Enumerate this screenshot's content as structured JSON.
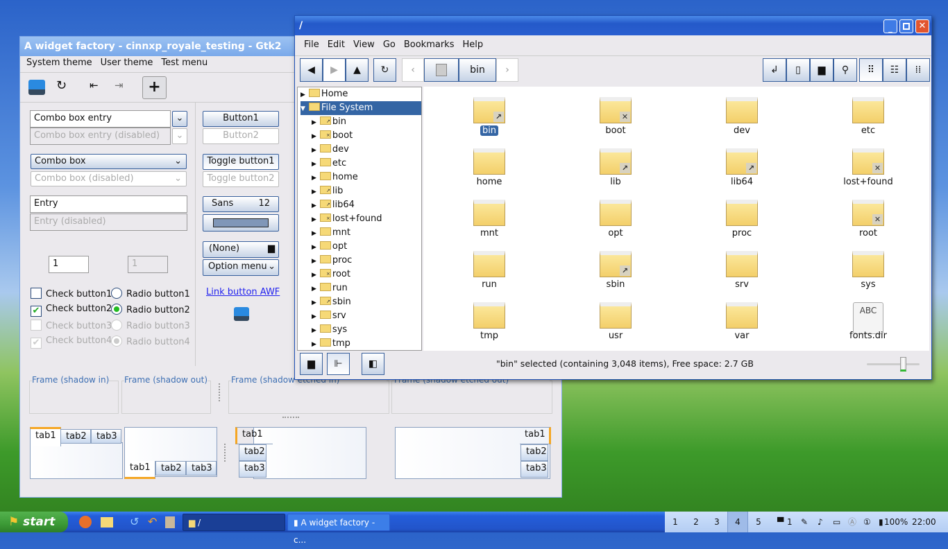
{
  "widget_window": {
    "title": "A widget factory - cinnxp_royale_testing - Gtk2",
    "menu": [
      "System theme",
      "User theme",
      "Test menu"
    ],
    "combo_entry": "Combo box entry",
    "combo_entry_disabled": "Combo box entry (disabled)",
    "combo": "Combo box",
    "combo_disabled": "Combo box (disabled)",
    "entry": "Entry",
    "entry_disabled": "Entry (disabled)",
    "spin": "1",
    "spin_disabled": "1",
    "checks": [
      "Check button1",
      "Check button2",
      "Check button3",
      "Check button4"
    ],
    "checks_state": [
      false,
      true,
      false,
      true
    ],
    "radios": [
      "Radio button1",
      "Radio button2",
      "Radio button3",
      "Radio button4"
    ],
    "button1": "Button1",
    "button2": "Button2",
    "toggle1": "Toggle button1",
    "toggle2": "Toggle button2",
    "font_name": "Sans",
    "font_size": "12",
    "file_chooser": "(None)",
    "option_menu": "Option menu",
    "link": "Link button AWF",
    "frames": [
      "Frame (shadow in)",
      "Frame (shadow out)",
      "Frame (shadow etched in)",
      "Frame (shadow etched out)"
    ],
    "tabs": [
      "tab1",
      "tab2",
      "tab3"
    ]
  },
  "file_manager": {
    "title": "/",
    "menu": [
      "File",
      "Edit",
      "View",
      "Go",
      "Bookmarks",
      "Help"
    ],
    "path_button": "bin",
    "tree": [
      {
        "n": "Home"
      },
      {
        "n": "File System",
        "sel": true
      },
      {
        "n": "bin",
        "b": "link"
      },
      {
        "n": "boot",
        "b": "x"
      },
      {
        "n": "dev"
      },
      {
        "n": "etc"
      },
      {
        "n": "home"
      },
      {
        "n": "lib",
        "b": "link"
      },
      {
        "n": "lib64",
        "b": "link"
      },
      {
        "n": "lost+found",
        "b": "x"
      },
      {
        "n": "mnt"
      },
      {
        "n": "opt"
      },
      {
        "n": "proc"
      },
      {
        "n": "root",
        "b": "x"
      },
      {
        "n": "run"
      },
      {
        "n": "sbin",
        "b": "link"
      },
      {
        "n": "srv"
      },
      {
        "n": "sys"
      },
      {
        "n": "tmp"
      }
    ],
    "files": [
      {
        "n": "bin",
        "b": "link",
        "sel": true
      },
      {
        "n": "boot",
        "b": "x"
      },
      {
        "n": "dev"
      },
      {
        "n": "etc"
      },
      {
        "n": "home"
      },
      {
        "n": "lib",
        "b": "link"
      },
      {
        "n": "lib64",
        "b": "link"
      },
      {
        "n": "lost+found",
        "b": "x"
      },
      {
        "n": "mnt"
      },
      {
        "n": "opt"
      },
      {
        "n": "proc"
      },
      {
        "n": "root",
        "b": "x"
      },
      {
        "n": "run"
      },
      {
        "n": "sbin",
        "b": "link"
      },
      {
        "n": "srv"
      },
      {
        "n": "sys"
      },
      {
        "n": "tmp"
      },
      {
        "n": "usr"
      },
      {
        "n": "var"
      },
      {
        "n": "fonts.dir",
        "type": "file",
        "thumb": "ABC"
      }
    ],
    "status": "\"bin\" selected (containing 3,048 items), Free space: 2.7 GB",
    "zoom_level": 0.3
  },
  "taskbar": {
    "start": "start",
    "tasks": [
      "/",
      "A widget factory - c..."
    ],
    "workspaces": [
      "1",
      "2",
      "3",
      "4",
      "5"
    ],
    "active_workspace": "4",
    "chat_count": "1",
    "battery": "100%",
    "clock": "22:00"
  }
}
